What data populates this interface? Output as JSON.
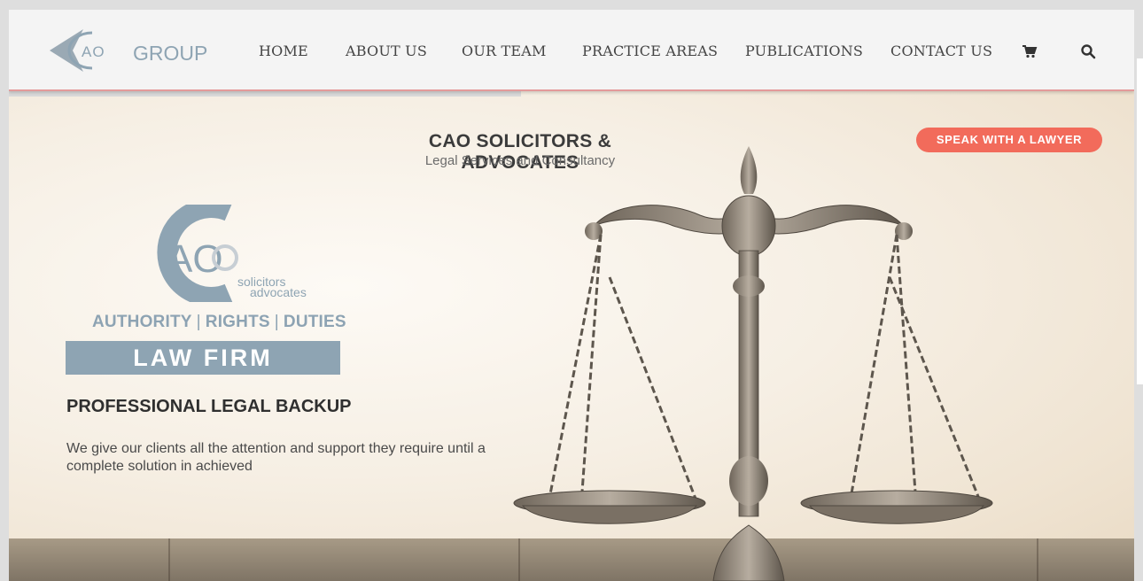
{
  "header": {
    "logo": {
      "letters": "AO",
      "word": "GROUP",
      "icon": "cao-group-logo"
    },
    "nav": [
      {
        "label": "HOME"
      },
      {
        "label": "ABOUT US"
      },
      {
        "label": "OUR TEAM"
      },
      {
        "label": "PRACTICE AREAS"
      },
      {
        "label": "PUBLICATIONS"
      },
      {
        "label": "CONTACT US"
      }
    ],
    "icons": {
      "cart": "cart-icon",
      "search": "search-icon"
    }
  },
  "hero": {
    "title": "CAO SOLICITORS & ADVOCATES",
    "subtitle": "Legal Services and Consultancy",
    "cta_label": "SPEAK WITH A LAWYER",
    "brand": {
      "letters": "AO",
      "line1": "solicitors",
      "line2": "advocates"
    },
    "tagline": [
      "AUTHORITY",
      "RIGHTS",
      "DUTIES"
    ],
    "tagline_separator": "|",
    "firm_label": "LAW FIRM",
    "heading": "PROFESSIONAL LEGAL BACKUP",
    "text": "We give our clients all the attention and support they require until a complete solution in achieved",
    "image": "scales-of-justice"
  },
  "colors": {
    "accent": "#f26b5b",
    "brand_blue_gray": "#8ea4b3",
    "header_border": "#e39a9a",
    "text_dark": "#2f2f2f"
  }
}
